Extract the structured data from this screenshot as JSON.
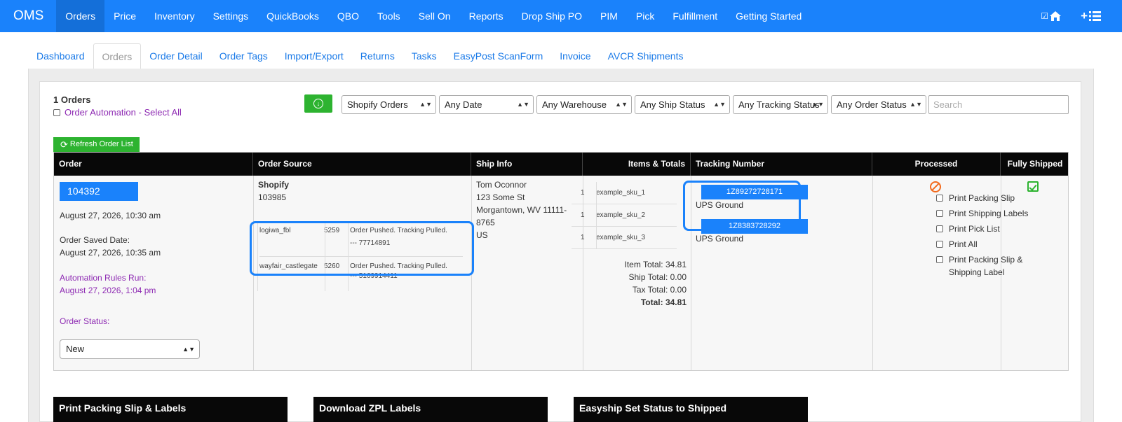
{
  "nav": {
    "brand": "OMS",
    "items": [
      "Orders",
      "Price",
      "Inventory",
      "Settings",
      "QuickBooks",
      "QBO",
      "Tools",
      "Sell On",
      "Reports",
      "Drop Ship PO",
      "PIM",
      "Pick",
      "Fulfillment",
      "Getting Started"
    ],
    "active": "Orders"
  },
  "subtabs": {
    "items": [
      "Dashboard",
      "Orders",
      "Order Detail",
      "Order Tags",
      "Import/Export",
      "Returns",
      "Tasks",
      "EasyPost ScanForm",
      "Invoice",
      "AVCR Shipments"
    ],
    "active": "Orders"
  },
  "toolbar": {
    "orders_count": "1 Orders",
    "automation_label": "Order Automation - Select All",
    "filters": [
      "Shopify Orders",
      "Any Date",
      "Any Warehouse",
      "Any Ship Status",
      "Any Tracking Status",
      "Any Order Status"
    ],
    "search_placeholder": "Search",
    "refresh_label": "Refresh Order List"
  },
  "table": {
    "headers": [
      "Order",
      "Order Source",
      "Ship Info",
      "Items & Totals",
      "Tracking Number",
      "Processed",
      "Fully Shipped"
    ],
    "order": {
      "id": "104392",
      "date": "August 27, 2026, 10:30 am",
      "saved_label": "Order Saved Date:",
      "saved_date": "August 27, 2026, 10:35 am",
      "rules_label": "Automation Rules Run:",
      "rules_date": "August 27, 2026, 1:04 pm",
      "status_label": "Order Status:",
      "status_value": "New"
    },
    "source": {
      "name": "Shopify",
      "number": "103985",
      "rows": [
        {
          "channel": "logiwa_fbl",
          "code": "5259",
          "status": "Order Pushed. Tracking Pulled.",
          "ref": "--- 77714891"
        },
        {
          "channel": "wayfair_castlegate",
          "code": "5260",
          "status": "Order Pushed. Tracking Pulled.",
          "ref": "--- 5169914411"
        }
      ]
    },
    "ship": {
      "name": "Tom Oconnor",
      "street": "123 Some St",
      "city": "Morgantown, WV 11111-",
      "zip": "8765",
      "country": "US"
    },
    "items": [
      {
        "qty": "1",
        "sku": "example_sku_1"
      },
      {
        "qty": "1",
        "sku": "example_sku_2"
      },
      {
        "qty": "1",
        "sku": "example_sku_3"
      }
    ],
    "totals": {
      "item": "Item Total: 34.81",
      "ship": "Ship Total: 0.00",
      "tax": "Tax Total: 0.00",
      "total": "Total: 34.81"
    },
    "tracking": [
      {
        "number": "1Z89272728171",
        "carrier": "UPS Ground"
      },
      {
        "number": "1Z8383728292",
        "carrier": "UPS Ground"
      }
    ],
    "processed_options": [
      "Print Packing Slip",
      "Print Shipping Labels",
      "Print Pick List",
      "Print All",
      "Print Packing Slip & Shipping Label"
    ]
  },
  "bottom_panels": [
    "Print Packing Slip & Labels",
    "Download ZPL Labels",
    "Easyship Set Status to Shipped"
  ],
  "colors": {
    "nav": "#1a82fb",
    "green": "#2db330",
    "purple": "#8e2bb3",
    "header": "#080808"
  }
}
